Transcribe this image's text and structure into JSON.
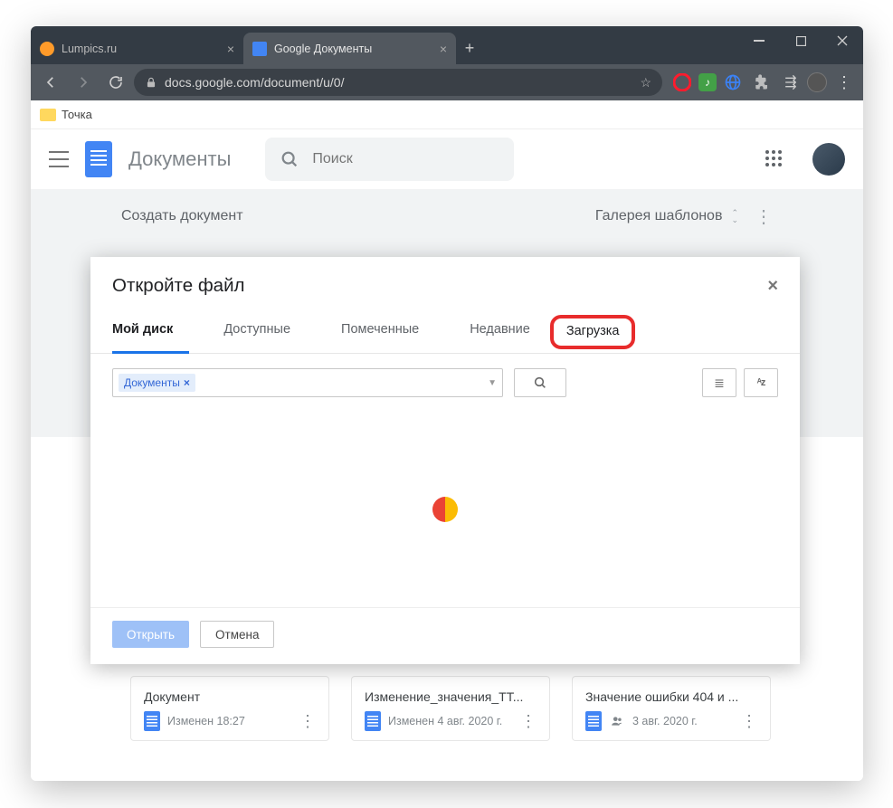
{
  "browser": {
    "tabs": [
      {
        "title": "Lumpics.ru",
        "favicon_color": "#ff9b2a",
        "active": false
      },
      {
        "title": "Google Документы",
        "favicon_color": "#4285f4",
        "active": true
      }
    ],
    "url_display": "docs.google.com/document/u/0/",
    "bookmarks": [
      {
        "label": "Точка"
      }
    ],
    "extensions": [
      "opera",
      "music",
      "globe",
      "puzzle",
      "reader"
    ]
  },
  "docs": {
    "app_name": "Документы",
    "search_placeholder": "Поиск",
    "templates_label": "Создать документ",
    "gallery_label": "Галерея шаблонов"
  },
  "dialog": {
    "title": "Откройте файл",
    "tabs": {
      "my_drive": "Мой диск",
      "shared": "Доступные",
      "starred": "Помеченные",
      "recent": "Недавние",
      "upload": "Загрузка"
    },
    "active_tab": "my_drive",
    "highlighted_tab": "upload",
    "filter_chip": "Документы",
    "buttons": {
      "open": "Открыть",
      "cancel": "Отмена"
    }
  },
  "cards": [
    {
      "title": "Документ",
      "meta": "Изменен 18:27",
      "shared": false
    },
    {
      "title": "Изменение_значения_TT...",
      "meta": "Изменен 4 авг. 2020 г.",
      "shared": false
    },
    {
      "title": "Значение ошибки 404 и ...",
      "meta": "3 авг. 2020 г.",
      "shared": true
    }
  ]
}
